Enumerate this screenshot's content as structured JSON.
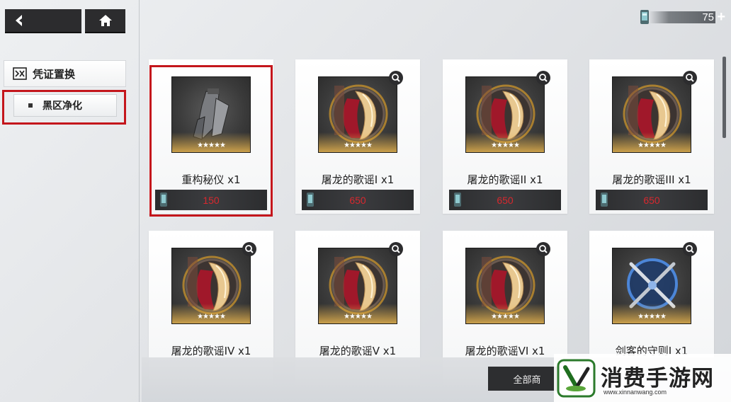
{
  "nav": {
    "back_icon": "chevron-left-icon",
    "home_icon": "home-icon"
  },
  "currency": {
    "icon": "ticket-icon",
    "count": "75",
    "plus": "+"
  },
  "sidebar": {
    "category_icon": "voucher-icon",
    "category_label": "凭证置换",
    "sub_label": "黑区净化"
  },
  "items": [
    {
      "name": "重构秘仪 x1",
      "price": "150",
      "stars": "★★★★★",
      "art": "gear"
    },
    {
      "name": "屠龙的歌谣I x1",
      "price": "650",
      "stars": "★★★★★",
      "art": "dragon"
    },
    {
      "name": "屠龙的歌谣II x1",
      "price": "650",
      "stars": "★★★★★",
      "art": "dragon"
    },
    {
      "name": "屠龙的歌谣III x1",
      "price": "650",
      "stars": "★★★★★",
      "art": "dragon"
    },
    {
      "name": "屠龙的歌谣IV x1",
      "stars": "★★★★★",
      "art": "dragon"
    },
    {
      "name": "屠龙的歌谣V x1",
      "stars": "★★★★★",
      "art": "dragon"
    },
    {
      "name": "屠龙的歌谣VI x1",
      "stars": "★★★★★",
      "art": "dragon"
    },
    {
      "name": "剑客的守则I x1",
      "stars": "★★★★★",
      "art": "swords"
    }
  ],
  "footer": {
    "all_button_label": "全部商"
  },
  "watermark": {
    "text": "消费手游网",
    "url": "www.xinnanwang.com"
  },
  "colors": {
    "price": "#d7282e",
    "highlight": "#c4161c",
    "dark_panel": "#2c2d2f"
  }
}
